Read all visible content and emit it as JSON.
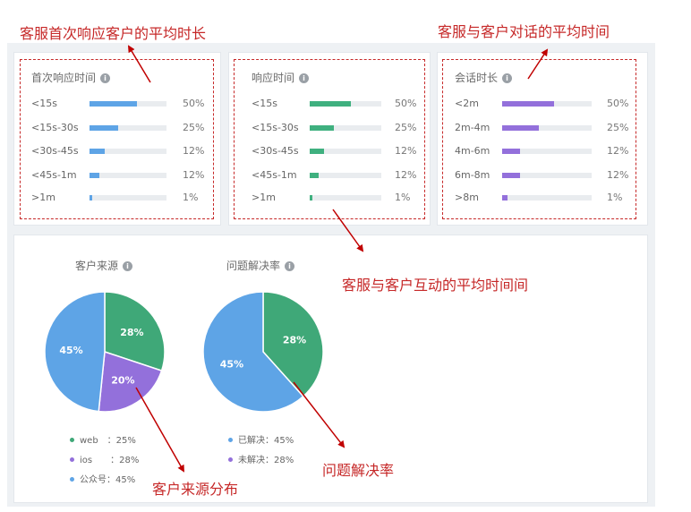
{
  "annotations": {
    "first_response": "客服首次响应客户的平均时长",
    "session_time": "客服与客户对话的平均时间",
    "interaction_time": "客服与客户互动的平均时间间",
    "source_dist": "客户来源分布",
    "resolution": "问题解决率"
  },
  "panels": [
    {
      "title": "首次响应时间",
      "color": "#5ea4e6",
      "rows": [
        {
          "label": "<15s",
          "pct": "50%",
          "fill": 0.62
        },
        {
          "label": "<15s-30s",
          "pct": "25%",
          "fill": 0.37
        },
        {
          "label": "<30s-45s",
          "pct": "12%",
          "fill": 0.2
        },
        {
          "label": "<45s-1m",
          "pct": "12%",
          "fill": 0.13
        },
        {
          "label": ">1m",
          "pct": "1%",
          "fill": 0.04
        }
      ]
    },
    {
      "title": "响应时间",
      "color": "#3fb07f",
      "rows": [
        {
          "label": "<15s",
          "pct": "50%",
          "fill": 0.58
        },
        {
          "label": "<15s-30s",
          "pct": "25%",
          "fill": 0.34
        },
        {
          "label": "<30s-45s",
          "pct": "12%",
          "fill": 0.2
        },
        {
          "label": "<45s-1m",
          "pct": "12%",
          "fill": 0.13
        },
        {
          "label": ">1m",
          "pct": "1%",
          "fill": 0.04
        }
      ]
    },
    {
      "title": "会话时长",
      "color": "#9370db",
      "rows": [
        {
          "label": "<2m",
          "pct": "50%",
          "fill": 0.58
        },
        {
          "label": "2m-4m",
          "pct": "25%",
          "fill": 0.41
        },
        {
          "label": "4m-6m",
          "pct": "12%",
          "fill": 0.2
        },
        {
          "label": "6m-8m",
          "pct": "12%",
          "fill": 0.2
        },
        {
          "label": ">8m",
          "pct": "1%",
          "fill": 0.06
        }
      ]
    }
  ],
  "chart_data": [
    {
      "type": "pie",
      "title": "客户来源",
      "slices": [
        {
          "name": "web",
          "value": 28,
          "label": "28%",
          "color": "#3fa878"
        },
        {
          "name": "ios",
          "value": 20,
          "label": "20%",
          "color": "#9370db"
        },
        {
          "name": "公众号",
          "value": 45,
          "label": "45%",
          "color": "#5ea4e6"
        }
      ],
      "legend": [
        {
          "text": "web　：25%",
          "color": "#3fa878"
        },
        {
          "text": "ios　　：28%",
          "color": "#9370db"
        },
        {
          "text": "公众号：45%",
          "color": "#5ea4e6"
        }
      ],
      "legend_position": "bottom"
    },
    {
      "type": "pie",
      "title": "问题解决率",
      "slices": [
        {
          "name": "已解决",
          "value": 28,
          "label": "28%",
          "color": "#3fa878"
        },
        {
          "name": "未解决",
          "value": 45,
          "label": "45%",
          "color": "#5ea4e6"
        }
      ],
      "legend": [
        {
          "text": "已解决：45%",
          "color": "#5ea4e6"
        },
        {
          "text": "未解决：28%",
          "color": "#9370db"
        }
      ],
      "legend_position": "bottom"
    }
  ]
}
